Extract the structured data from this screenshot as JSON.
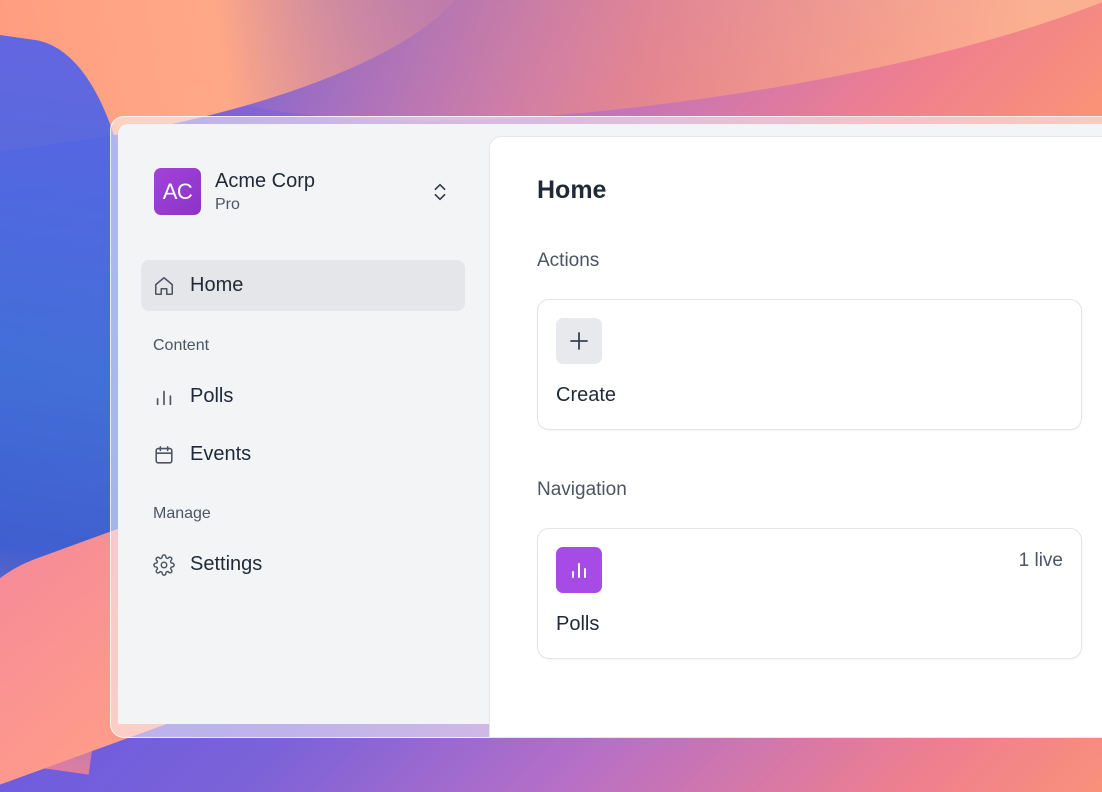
{
  "sidebar": {
    "org": {
      "initials": "AC",
      "name": "Acme Corp",
      "plan": "Pro",
      "switcher_icon": "chevron-up-down-icon"
    },
    "items": [
      {
        "label": "Home",
        "icon": "home-icon",
        "active": true
      },
      {
        "label": "Polls",
        "icon": "bar-chart-icon",
        "section": "Content"
      },
      {
        "label": "Events",
        "icon": "calendar-icon",
        "section": "Content"
      },
      {
        "label": "Settings",
        "icon": "gear-icon",
        "section": "Manage"
      }
    ],
    "sections": [
      "Content",
      "Manage"
    ]
  },
  "main": {
    "title": "Home",
    "actions": {
      "heading": "Actions",
      "cards": [
        {
          "label": "Create",
          "icon": "plus-icon"
        }
      ]
    },
    "navigation": {
      "heading": "Navigation",
      "cards": [
        {
          "label": "Polls",
          "icon": "bar-chart-icon",
          "badge": "1 live"
        }
      ]
    }
  },
  "colors": {
    "accent": "#a64be6",
    "avatar": "#9b3fd2",
    "sidebar_bg": "#f3f4f6",
    "active_item_bg": "#e5e6ea"
  }
}
